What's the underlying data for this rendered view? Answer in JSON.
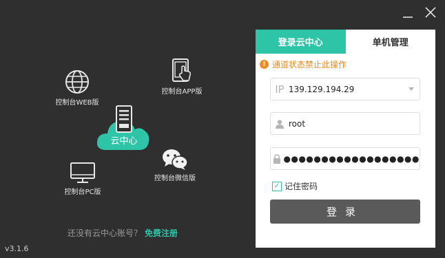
{
  "window": {
    "minimize_icon": "minimize-icon",
    "close_icon": "close-icon"
  },
  "left": {
    "web_label": "控制台WEB版",
    "app_label": "控制台APP版",
    "cloud_label": "云中心",
    "pc_label": "控制台PC版",
    "wechat_label": "控制台微信版",
    "register_prompt": "还没有云中心账号？",
    "register_link": "免费注册",
    "version": "v3.1.6"
  },
  "panel": {
    "tabs": [
      {
        "label": "登录云中心",
        "active": true
      },
      {
        "label": "单机管理",
        "active": false
      }
    ],
    "warning": "通道状态禁止此操作",
    "ip_prefix": "IP",
    "ip_value": "139.129.194.29",
    "username": "root",
    "password_mask": "●●●●●●●●●●●●●●●●●●",
    "remember_label": "记住密码",
    "remember_checked": true,
    "login_label": "登录"
  },
  "colors": {
    "accent": "#2ec4a7",
    "background": "#2f2f2f",
    "warning": "#e88a1f",
    "button": "#5a5a5a"
  }
}
